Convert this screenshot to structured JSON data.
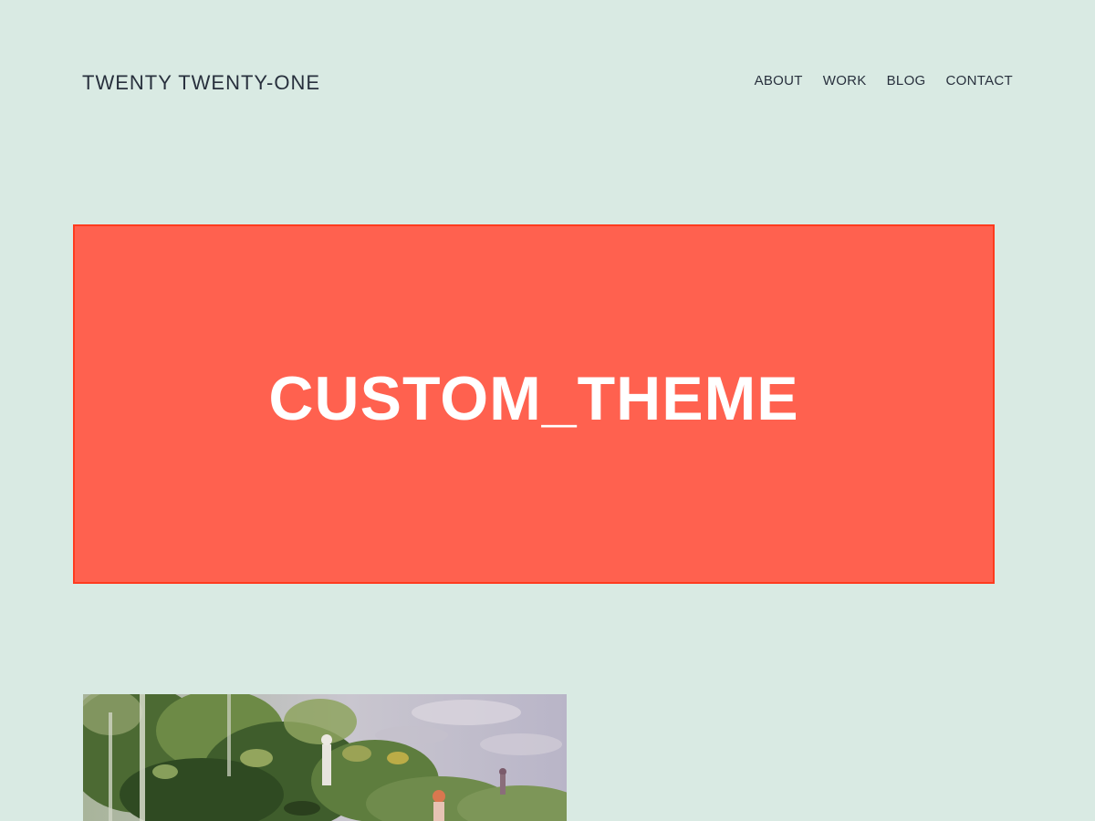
{
  "header": {
    "site_title": "TWENTY TWENTY-ONE",
    "nav": [
      {
        "label": "ABOUT"
      },
      {
        "label": "WORK"
      },
      {
        "label": "BLOG"
      },
      {
        "label": "CONTACT"
      }
    ]
  },
  "banner": {
    "text": "CUSTOM_THEME",
    "background_color": "#ff614f",
    "border_color": "#ff3b1f"
  },
  "colors": {
    "page_background": "#d9eae3",
    "text": "#28303d"
  },
  "image": {
    "icon": "impressionist-painting-garden"
  }
}
